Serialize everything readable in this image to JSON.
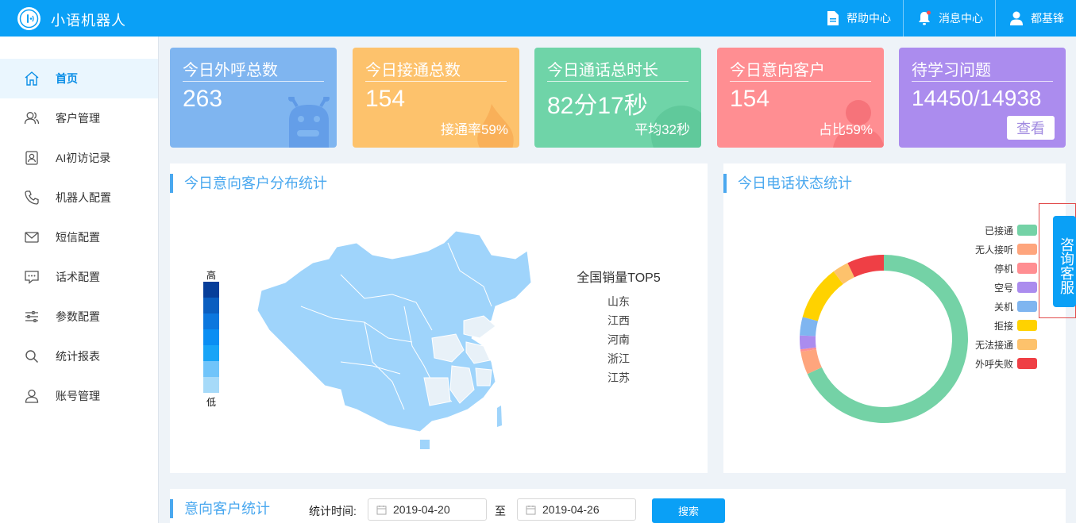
{
  "header": {
    "app_title": "小语机器人",
    "help_label": "帮助中心",
    "message_label": "消息中心",
    "user_name": "都基锋"
  },
  "sidebar": {
    "items": [
      {
        "label": "首页",
        "icon": "home-icon",
        "active": true
      },
      {
        "label": "客户管理",
        "icon": "users-icon"
      },
      {
        "label": "AI初访记录",
        "icon": "contact-card-icon"
      },
      {
        "label": "机器人配置",
        "icon": "phone-icon"
      },
      {
        "label": "短信配置",
        "icon": "mail-icon"
      },
      {
        "label": "话术配置",
        "icon": "chat-icon"
      },
      {
        "label": "参数配置",
        "icon": "sliders-icon"
      },
      {
        "label": "统计报表",
        "icon": "search-icon"
      },
      {
        "label": "账号管理",
        "icon": "user-icon"
      }
    ]
  },
  "stats": [
    {
      "title": "今日外呼总数",
      "value": "263",
      "sub": "",
      "color": "#7fb5f0"
    },
    {
      "title": "今日接通总数",
      "value": "154",
      "sub": "接通率59%",
      "color": "#fdc26c"
    },
    {
      "title": "今日通话总时长",
      "value": "82分17秒",
      "sub": "平均32秒",
      "color": "#6fd4a8"
    },
    {
      "title": "今日意向客户",
      "value": "154",
      "sub": "占比59%",
      "color": "#ff8e92"
    },
    {
      "title": "待学习问题",
      "value": "14450/14938",
      "sub": "",
      "button": "查看",
      "color": "#ab8cee"
    }
  ],
  "map_panel": {
    "title": "今日意向客户分布统计",
    "legend_high": "高",
    "legend_low": "低",
    "top5_title": "全国销量TOP5",
    "top5": [
      "山东",
      "江西",
      "河南",
      "浙江",
      "江苏"
    ]
  },
  "call_panel": {
    "title": "今日电话状态统计"
  },
  "chart_data": {
    "type": "pie",
    "categories": [
      "已接通",
      "无人接听",
      "停机",
      "空号",
      "关机",
      "拒接",
      "无法接通",
      "外呼失败"
    ],
    "values": [
      154,
      10,
      1,
      6,
      8,
      24,
      7,
      16
    ],
    "colors": [
      "#74d2a6",
      "#fea57d",
      "#ff8e92",
      "#ab8cee",
      "#7fb5f0",
      "#ffd200",
      "#fdc26c",
      "#ef3f45"
    ],
    "donut": true,
    "legend": "right"
  },
  "intent_panel": {
    "title": "意向客户统计",
    "time_label": "统计时间:",
    "start_date": "2019-04-20",
    "to_label": "至",
    "end_date": "2019-04-26",
    "search_label": "搜索"
  },
  "consult": {
    "label": "咨询客服"
  }
}
